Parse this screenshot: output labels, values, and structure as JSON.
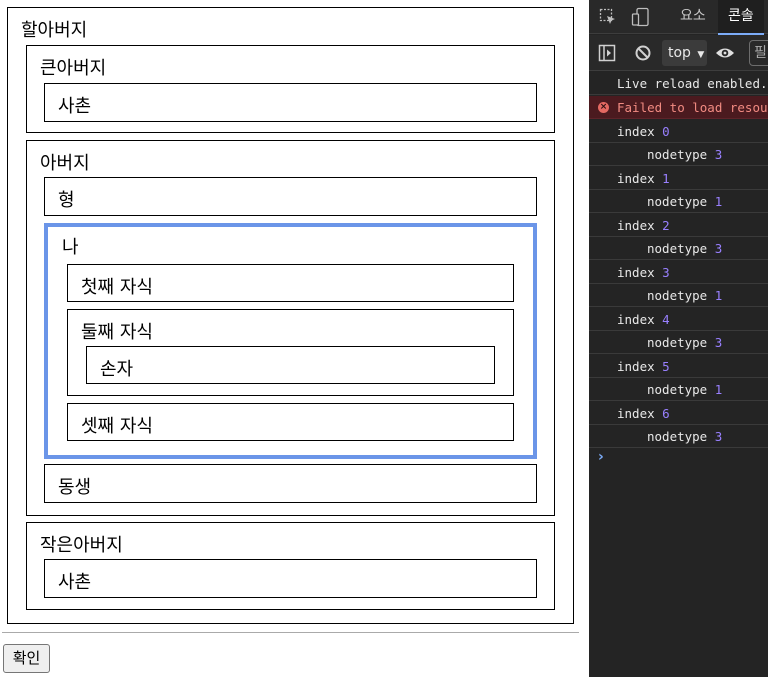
{
  "tree": {
    "grandfather": "할아버지",
    "big_uncle": "큰아버지",
    "cousin_1": "사촌",
    "father": "아버지",
    "older_brother": "형",
    "me": "나",
    "first_child": "첫째 자식",
    "second_child": "둘째 자식",
    "grandchild": "손자",
    "third_child": "셋째 자식",
    "younger_sibling": "동생",
    "small_uncle": "작은아버지",
    "cousin_2": "사촌"
  },
  "confirm_button": "확인",
  "devtools": {
    "tabs": [
      "요소",
      "콘솔"
    ],
    "active_tab": "콘솔",
    "context": "top",
    "filter_placeholder": "필",
    "icons": [
      "inspect-icon",
      "device-toggle-icon",
      "sidebar-toggle-icon",
      "clear-console-icon",
      "eye-icon"
    ],
    "messages": [
      {
        "type": "log",
        "text": "Live reload enabled."
      },
      {
        "type": "error",
        "text": "Failed to load resou"
      },
      {
        "type": "log",
        "label": "index",
        "value": "0"
      },
      {
        "type": "log",
        "label": "nodetype",
        "value": "3",
        "indent": true
      },
      {
        "type": "log",
        "label": "index",
        "value": "1"
      },
      {
        "type": "log",
        "label": "nodetype",
        "value": "1",
        "indent": true
      },
      {
        "type": "log",
        "label": "index",
        "value": "2"
      },
      {
        "type": "log",
        "label": "nodetype",
        "value": "3",
        "indent": true
      },
      {
        "type": "log",
        "label": "index",
        "value": "3"
      },
      {
        "type": "log",
        "label": "nodetype",
        "value": "1",
        "indent": true
      },
      {
        "type": "log",
        "label": "index",
        "value": "4"
      },
      {
        "type": "log",
        "label": "nodetype",
        "value": "3",
        "indent": true
      },
      {
        "type": "log",
        "label": "index",
        "value": "5"
      },
      {
        "type": "log",
        "label": "nodetype",
        "value": "1",
        "indent": true
      },
      {
        "type": "log",
        "label": "index",
        "value": "6"
      },
      {
        "type": "log",
        "label": "nodetype",
        "value": "3",
        "indent": true
      }
    ],
    "prompt": "›",
    "colors": {
      "background": "#242424",
      "error_bg": "#4b1a1f",
      "error_text": "#f28b82",
      "number": "#9980ff",
      "accent": "#7cacf8"
    }
  }
}
